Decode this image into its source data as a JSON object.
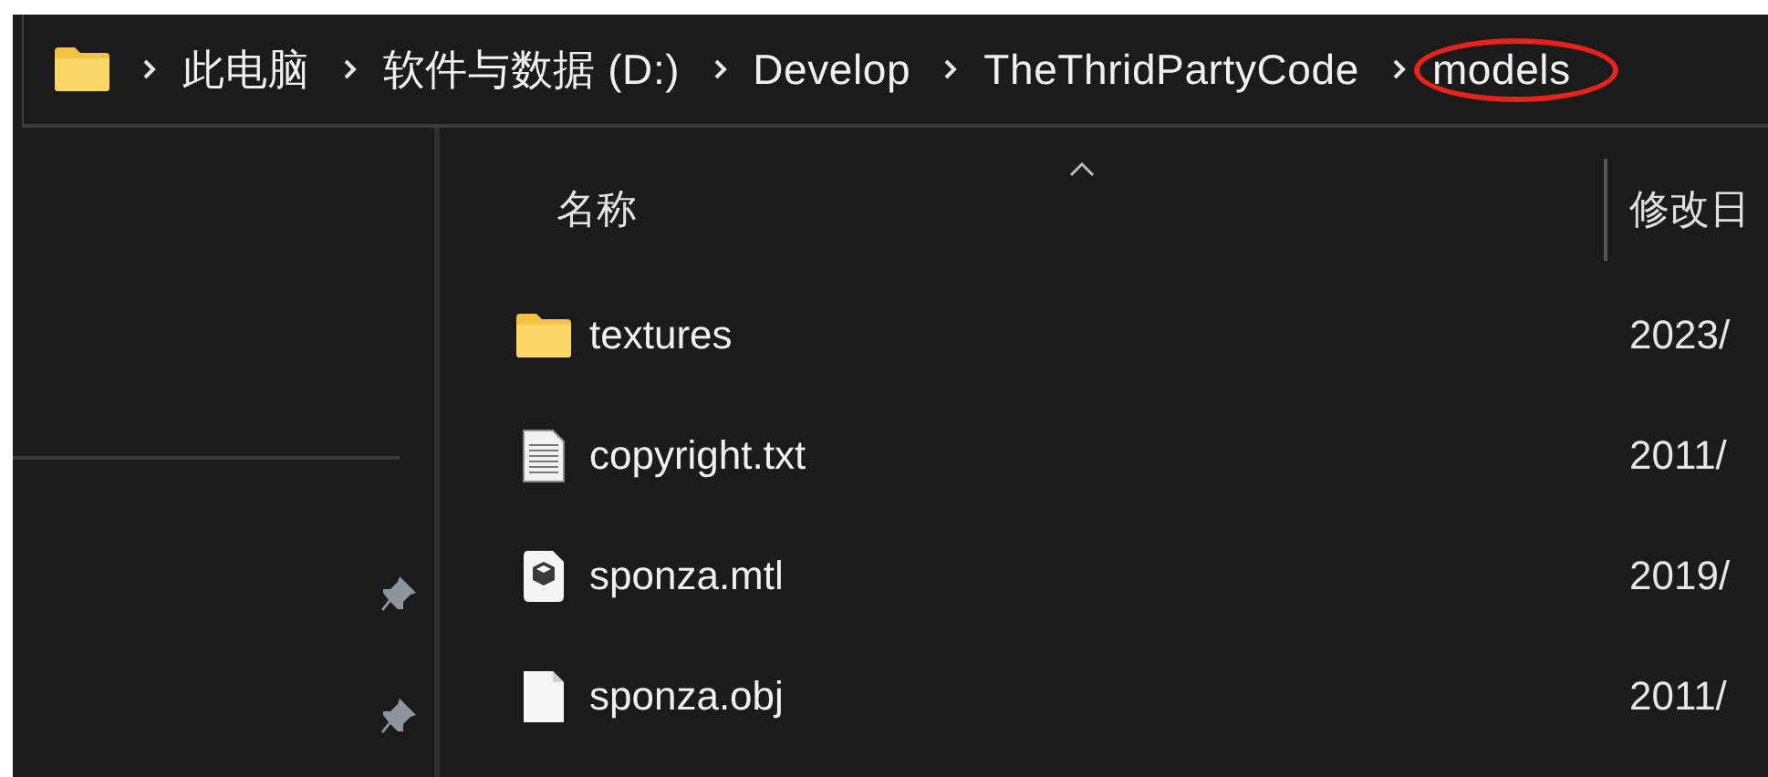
{
  "address_bar": {
    "path": [
      {
        "label": "此电脑",
        "circled": false
      },
      {
        "label": "软件与数据 (D:)",
        "circled": false
      },
      {
        "label": "Develop",
        "circled": false
      },
      {
        "label": "TheThridPartyCode",
        "circled": false
      },
      {
        "label": "models",
        "circled": true
      }
    ]
  },
  "quick_access": [
    {
      "pinned": true
    },
    {
      "pinned": true
    }
  ],
  "file_list": {
    "columns": [
      {
        "label": "名称",
        "sorted": true
      },
      {
        "label": "修改日",
        "sorted": false
      }
    ],
    "rows": [
      {
        "kind": "folder",
        "name": "textures",
        "modified": "2023/"
      },
      {
        "kind": "text",
        "name": "copyright.txt",
        "modified": "2011/"
      },
      {
        "kind": "model",
        "name": "sponza.mtl",
        "modified": "2019/"
      },
      {
        "kind": "file",
        "name": "sponza.obj",
        "modified": "2011/"
      }
    ]
  }
}
